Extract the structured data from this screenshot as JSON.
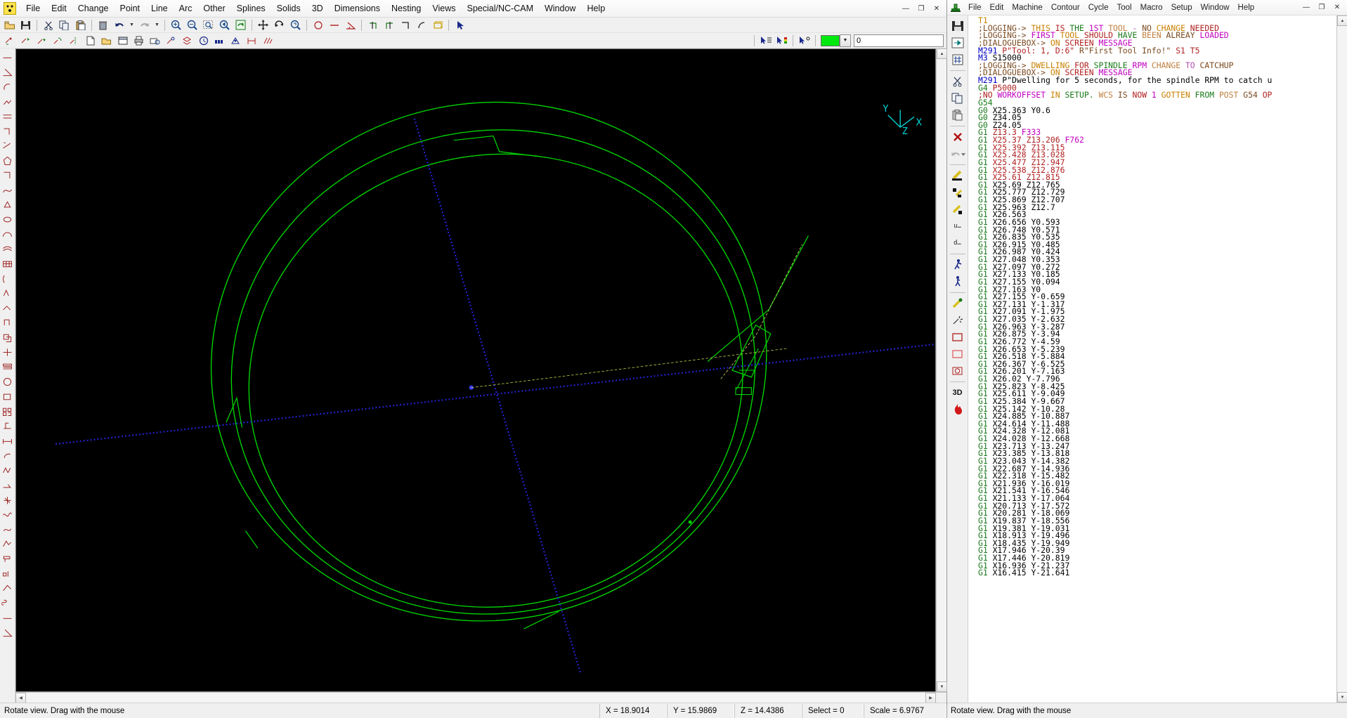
{
  "cad_window": {
    "app_icon": "checkered-logo-icon",
    "menu": [
      "File",
      "Edit",
      "Change",
      "Point",
      "Line",
      "Arc",
      "Other",
      "Splines",
      "Solids",
      "3D",
      "Dimensions",
      "Nesting",
      "Views",
      "Special/NC-CAM",
      "Window",
      "Help"
    ],
    "window_buttons": [
      "minimize",
      "restore",
      "close"
    ],
    "toolbar_row1": [
      "open-icon",
      "save-icon",
      "sep",
      "cut-icon",
      "copy-icon",
      "paste-icon",
      "sep",
      "delete-icon",
      "undo-icon",
      "undo-dropdown-icon",
      "redo-icon",
      "redo-dropdown-icon",
      "sep",
      "zoom-in-icon",
      "zoom-out-icon",
      "zoom-window-icon",
      "zoom-previous-icon",
      "zoom-all-icon",
      "sep",
      "pan-icon",
      "rotate-icon",
      "dynamic-zoom-icon",
      "sep",
      "circle-icon",
      "line-icon",
      "angle-icon",
      "sep",
      "trim-start-icon",
      "trim-end-icon",
      "corner-icon",
      "fillet-icon",
      "rectangle-icon",
      "sep",
      "select-icon"
    ],
    "toolbar_row2": [
      "point-new-icon",
      "point-move-icon",
      "point-copy-icon",
      "point-rotate-icon",
      "point-mirror-icon",
      "file-new-icon",
      "file-open2-icon",
      "window-icon",
      "print-icon",
      "print-preview-icon",
      "props-icon",
      "layers-icon",
      "clock-icon",
      "grid-icon",
      "snap-icon",
      "dim-icon",
      "hatch-icon"
    ],
    "toolbar_row2_right": [
      "list-select-icon",
      "color-select-icon",
      "point-select-icon"
    ],
    "color_swatch": "#00e810",
    "layer_value": "0",
    "vertical_tools": [
      "line-icon",
      "angle-line-icon",
      "arc-icon",
      "polyline-icon",
      "parallel-icon",
      "corner-icon",
      "xyz-axis-icon",
      "polygon-icon",
      "rect-corner-icon",
      "spline-icon",
      "shape-fill-icon",
      "ellipse-icon",
      "dome-icon",
      "surface-icon",
      "grid-surface-icon",
      "mesh-icon",
      "revolve-icon",
      "sweep-icon",
      "loft-icon",
      "extrude-icon",
      "boolean-icon",
      "section-icon",
      "table-icon",
      "sphere-icon",
      "block-icon",
      "array-icon",
      "text-icon",
      "dim-linear-icon",
      "dim-angular-icon",
      "hatch2-icon",
      "measure-icon",
      "leader-icon",
      "symbol-icon",
      "wave-icon",
      "curve-icon",
      "nc-path-icon",
      "pocket-icon",
      "drill-icon",
      "contour-icon",
      "helix-icon"
    ],
    "viewport": {
      "background": "#000000",
      "geometry_color": "#00d400",
      "toolpath_color": "#2020c0",
      "axis_label_x": "X",
      "axis_label_y": "Y",
      "axis_label_z": "Z"
    },
    "statusbar": {
      "message": "Rotate view.  Drag with the mouse",
      "x": "X = 18.9014",
      "y": "Y = 15.9869",
      "z": "Z = 14.4386",
      "select": "Select = 0",
      "scale": "Scale = 6.9767"
    }
  },
  "nc_window": {
    "app_icon": "nc-vise-icon",
    "menu": [
      "File",
      "Edit",
      "Machine",
      "Contour",
      "Cycle",
      "Tool",
      "Macro",
      "Setup",
      "Window",
      "Help"
    ],
    "window_buttons": [
      "minimize",
      "restore",
      "close"
    ],
    "vertical_tools": [
      "save-icon",
      "export-icon",
      "post-icon",
      "sep",
      "cut-icon",
      "copy-icon",
      "paste-icon",
      "sep",
      "delete-red-icon",
      "undo-icon",
      "undo-dropdown-icon",
      "sep",
      "tool-yellow-icon",
      "tool-black-icon",
      "tool-mixed-icon",
      "u-list-icon",
      "d-list-icon",
      "sep",
      "run-icon",
      "step-icon",
      "sep",
      "sim-icon",
      "spark-icon",
      "stock-rect-icon",
      "stock-red-icon",
      "stock-circle-icon",
      "sep",
      "3d-label",
      "flame-icon"
    ],
    "statusbar": {
      "message": "Rotate view.  Drag with the mouse"
    },
    "gcode_lines": [
      [
        [
          "T1",
          "k-o"
        ]
      ],
      [
        [
          ";LOGGING-> THIS IS THE 1ST TOOL - NO CHANGE NEEDED",
          "k-mix1"
        ]
      ],
      [
        [
          ";LOGGING-> FIRST TOOL SHOULD HAVE BEEN ALREAY LOADED",
          "k-mix2"
        ]
      ],
      [
        [
          ";DIALOGUEBOX-> ON SCREEN MESSAGE",
          "k-mix3"
        ]
      ],
      [
        [
          "M291 ",
          "k-gb"
        ],
        [
          "P\"Tool: 1, D:6\" ",
          "k-r"
        ],
        [
          "R\"First Tool Info!\" ",
          "k-n"
        ],
        [
          "S1 T5",
          "k-r"
        ]
      ],
      [
        [
          "M3 ",
          "k-gb"
        ],
        [
          "S15000",
          "k-d"
        ]
      ],
      [
        [
          ";LOGGING-> DWELLING FOR SPINDLE RPM CHANGE TO CATCHUP",
          "k-mix1"
        ]
      ],
      [
        [
          ";DIALOGUEBOX-> ON SCREEN MESSAGE",
          "k-mix3"
        ]
      ],
      [
        [
          "M291 ",
          "k-gb"
        ],
        [
          "P\"Dwelling for 5 seconds, for the spindle RPM to catch u",
          "k-d"
        ]
      ],
      [
        [
          "G4 ",
          "k-g"
        ],
        [
          "P5000",
          "k-r"
        ]
      ],
      [
        [
          ";NO WORKOFFSET IN SETUP. WCS IS NOW 1 GOTTEN FROM POST G54 OP",
          "k-mix4"
        ]
      ],
      [
        [
          "G54",
          "k-g"
        ]
      ],
      [
        [
          "G0 ",
          "k-g"
        ],
        [
          "X25.363 Y0.6",
          "k-d"
        ]
      ],
      [
        [
          "G0 ",
          "k-g"
        ],
        [
          "Z34.05",
          "k-d"
        ]
      ],
      [
        [
          "G0 ",
          "k-g"
        ],
        [
          "Z24.05",
          "k-d"
        ]
      ],
      [
        [
          "G1 ",
          "k-g"
        ],
        [
          "Z13.3 ",
          "k-r"
        ],
        [
          "F333",
          "k-m"
        ]
      ],
      [
        [
          "G1 ",
          "k-g"
        ],
        [
          "X25.37 Z13.206 ",
          "k-r"
        ],
        [
          "F762",
          "k-m"
        ]
      ],
      [
        [
          "G1 ",
          "k-g"
        ],
        [
          "X25.392 Z13.115",
          "k-r"
        ]
      ],
      [
        [
          "G1 ",
          "k-g"
        ],
        [
          "X25.428 Z13.028",
          "k-r"
        ]
      ],
      [
        [
          "G1 ",
          "k-g"
        ],
        [
          "X25.477 Z12.947",
          "k-r"
        ]
      ],
      [
        [
          "G1 ",
          "k-g"
        ],
        [
          "X25.538 Z12.876",
          "k-r"
        ]
      ],
      [
        [
          "G1 ",
          "k-g"
        ],
        [
          "X25.61 Z12.815",
          "k-r"
        ]
      ],
      [
        [
          "G1 ",
          "k-g"
        ],
        [
          "X25.69 Z12.765",
          "k-d"
        ]
      ],
      [
        [
          "G1 ",
          "k-g"
        ],
        [
          "X25.777 Z12.729",
          "k-d"
        ]
      ],
      [
        [
          "G1 ",
          "k-g"
        ],
        [
          "X25.869 Z12.707",
          "k-d"
        ]
      ],
      [
        [
          "G1 ",
          "k-g"
        ],
        [
          "X25.963 Z12.7",
          "k-d"
        ]
      ],
      [
        [
          "G1 ",
          "k-g"
        ],
        [
          "X26.563",
          "k-d"
        ]
      ],
      [
        [
          "G1 ",
          "k-g"
        ],
        [
          "X26.656 Y0.593",
          "k-d"
        ]
      ],
      [
        [
          "G1 ",
          "k-g"
        ],
        [
          "X26.748 Y0.571",
          "k-d"
        ]
      ],
      [
        [
          "G1 ",
          "k-g"
        ],
        [
          "X26.835 Y0.535",
          "k-d"
        ]
      ],
      [
        [
          "G1 ",
          "k-g"
        ],
        [
          "X26.915 Y0.485",
          "k-d"
        ]
      ],
      [
        [
          "G1 ",
          "k-g"
        ],
        [
          "X26.987 Y0.424",
          "k-d"
        ]
      ],
      [
        [
          "G1 ",
          "k-g"
        ],
        [
          "X27.048 Y0.353",
          "k-d"
        ]
      ],
      [
        [
          "G1 ",
          "k-g"
        ],
        [
          "X27.097 Y0.272",
          "k-d"
        ]
      ],
      [
        [
          "G1 ",
          "k-g"
        ],
        [
          "X27.133 Y0.185",
          "k-d"
        ]
      ],
      [
        [
          "G1 ",
          "k-g"
        ],
        [
          "X27.155 Y0.094",
          "k-d"
        ]
      ],
      [
        [
          "G1 ",
          "k-g"
        ],
        [
          "X27.163 Y0",
          "k-d"
        ]
      ],
      [
        [
          "G1 ",
          "k-g"
        ],
        [
          "X27.155 Y-0.659",
          "k-d"
        ]
      ],
      [
        [
          "G1 ",
          "k-g"
        ],
        [
          "X27.131 Y-1.317",
          "k-d"
        ]
      ],
      [
        [
          "G1 ",
          "k-g"
        ],
        [
          "X27.091 Y-1.975",
          "k-d"
        ]
      ],
      [
        [
          "G1 ",
          "k-g"
        ],
        [
          "X27.035 Y-2.632",
          "k-d"
        ]
      ],
      [
        [
          "G1 ",
          "k-g"
        ],
        [
          "X26.963 Y-3.287",
          "k-d"
        ]
      ],
      [
        [
          "G1 ",
          "k-g"
        ],
        [
          "X26.875 Y-3.94",
          "k-d"
        ]
      ],
      [
        [
          "G1 ",
          "k-g"
        ],
        [
          "X26.772 Y-4.59",
          "k-d"
        ]
      ],
      [
        [
          "G1 ",
          "k-g"
        ],
        [
          "X26.653 Y-5.239",
          "k-d"
        ]
      ],
      [
        [
          "G1 ",
          "k-g"
        ],
        [
          "X26.518 Y-5.884",
          "k-d"
        ]
      ],
      [
        [
          "G1 ",
          "k-g"
        ],
        [
          "X26.367 Y-6.525",
          "k-d"
        ]
      ],
      [
        [
          "G1 ",
          "k-g"
        ],
        [
          "X26.201 Y-7.163",
          "k-d"
        ]
      ],
      [
        [
          "G1 ",
          "k-g"
        ],
        [
          "X26.02 Y-7.796",
          "k-d"
        ]
      ],
      [
        [
          "G1 ",
          "k-g"
        ],
        [
          "X25.823 Y-8.425",
          "k-d"
        ]
      ],
      [
        [
          "G1 ",
          "k-g"
        ],
        [
          "X25.611 Y-9.049",
          "k-d"
        ]
      ],
      [
        [
          "G1 ",
          "k-g"
        ],
        [
          "X25.384 Y-9.667",
          "k-d"
        ]
      ],
      [
        [
          "G1 ",
          "k-g"
        ],
        [
          "X25.142 Y-10.28",
          "k-d"
        ]
      ],
      [
        [
          "G1 ",
          "k-g"
        ],
        [
          "X24.885 Y-10.887",
          "k-d"
        ]
      ],
      [
        [
          "G1 ",
          "k-g"
        ],
        [
          "X24.614 Y-11.488",
          "k-d"
        ]
      ],
      [
        [
          "G1 ",
          "k-g"
        ],
        [
          "X24.328 Y-12.081",
          "k-d"
        ]
      ],
      [
        [
          "G1 ",
          "k-g"
        ],
        [
          "X24.028 Y-12.668",
          "k-d"
        ]
      ],
      [
        [
          "G1 ",
          "k-g"
        ],
        [
          "X23.713 Y-13.247",
          "k-d"
        ]
      ],
      [
        [
          "G1 ",
          "k-g"
        ],
        [
          "X23.385 Y-13.818",
          "k-d"
        ]
      ],
      [
        [
          "G1 ",
          "k-g"
        ],
        [
          "X23.043 Y-14.382",
          "k-d"
        ]
      ],
      [
        [
          "G1 ",
          "k-g"
        ],
        [
          "X22.687 Y-14.936",
          "k-d"
        ]
      ],
      [
        [
          "G1 ",
          "k-g"
        ],
        [
          "X22.318 Y-15.482",
          "k-d"
        ]
      ],
      [
        [
          "G1 ",
          "k-g"
        ],
        [
          "X21.936 Y-16.019",
          "k-d"
        ]
      ],
      [
        [
          "G1 ",
          "k-g"
        ],
        [
          "X21.541 Y-16.546",
          "k-d"
        ]
      ],
      [
        [
          "G1 ",
          "k-g"
        ],
        [
          "X21.133 Y-17.064",
          "k-d"
        ]
      ],
      [
        [
          "G1 ",
          "k-g"
        ],
        [
          "X20.713 Y-17.572",
          "k-d"
        ]
      ],
      [
        [
          "G1 ",
          "k-g"
        ],
        [
          "X20.281 Y-18.069",
          "k-d"
        ]
      ],
      [
        [
          "G1 ",
          "k-g"
        ],
        [
          "X19.837 Y-18.556",
          "k-d"
        ]
      ],
      [
        [
          "G1 ",
          "k-g"
        ],
        [
          "X19.381 Y-19.031",
          "k-d"
        ]
      ],
      [
        [
          "G1 ",
          "k-g"
        ],
        [
          "X18.913 Y-19.496",
          "k-d"
        ]
      ],
      [
        [
          "G1 ",
          "k-g"
        ],
        [
          "X18.435 Y-19.949",
          "k-d"
        ]
      ],
      [
        [
          "G1 ",
          "k-g"
        ],
        [
          "X17.946 Y-20.39",
          "k-d"
        ]
      ],
      [
        [
          "G1 ",
          "k-g"
        ],
        [
          "X17.446 Y-20.819",
          "k-d"
        ]
      ],
      [
        [
          "G1 ",
          "k-g"
        ],
        [
          "X16.936 Y-21.237",
          "k-d"
        ]
      ],
      [
        [
          "G1 ",
          "k-g"
        ],
        [
          "X16.415 Y-21.641",
          "k-d"
        ]
      ]
    ]
  }
}
